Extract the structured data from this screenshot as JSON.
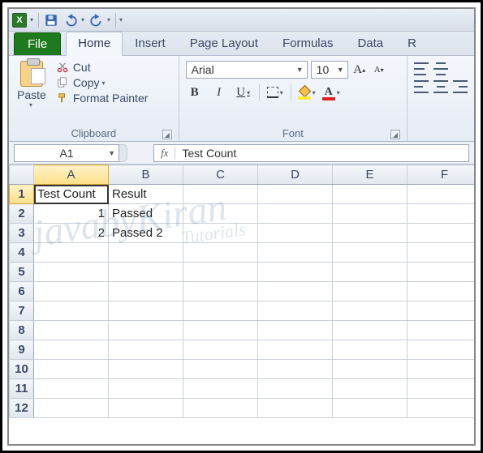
{
  "qat": {
    "app_letter": "X"
  },
  "tabs": {
    "file": "File",
    "items": [
      "Home",
      "Insert",
      "Page Layout",
      "Formulas",
      "Data",
      "R"
    ],
    "active_index": 0
  },
  "ribbon": {
    "clipboard": {
      "paste": "Paste",
      "cut": "Cut",
      "copy": "Copy",
      "format_painter": "Format Painter",
      "group_label": "Clipboard"
    },
    "font": {
      "name": "Arial",
      "size": "10",
      "bold": "B",
      "italic": "I",
      "underline": "U",
      "inc_font": "A",
      "dec_font": "A",
      "font_color_letter": "A",
      "group_label": "Font"
    }
  },
  "formula_bar": {
    "name_box": "A1",
    "fx": "fx",
    "value": "Test Count"
  },
  "grid": {
    "columns": [
      "A",
      "B",
      "C",
      "D",
      "E",
      "F"
    ],
    "rows": [
      "1",
      "2",
      "3",
      "4",
      "5",
      "6",
      "7",
      "8",
      "9",
      "10",
      "11",
      "12"
    ],
    "active_cell": "A1",
    "data": {
      "A1": "Test Count",
      "B1": "Result",
      "A2": "1",
      "B2": "Passed",
      "A3": "2",
      "B3": "Passed 2"
    }
  },
  "watermark": {
    "main": "javabyKiran",
    "sub": "Tutorials"
  }
}
